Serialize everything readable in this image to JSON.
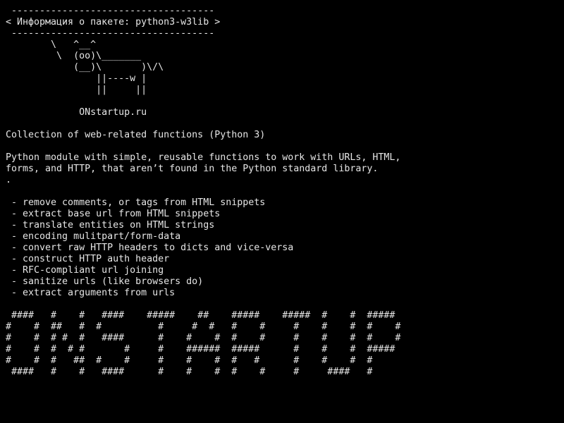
{
  "theme": {
    "background": "#000000",
    "foreground": "#e6e6e6"
  },
  "terminal": {
    "lines": [
      " ------------------------------------",
      "< Информация о пакете: python3-w3lib >",
      " ------------------------------------",
      "        \\   ^__^",
      "         \\  (oo)\\_______",
      "            (__)\\       )\\/\\",
      "                ||----w |",
      "                ||     ||",
      "",
      "             ONstartup.ru",
      "",
      "Collection of web-related functions (Python 3)",
      "",
      "Python module with simple, reusable functions to work with URLs, HTML,",
      "forms, and HTTP, that aren’t found in the Python standard library.",
      ".",
      "",
      " - remove comments, or tags from HTML snippets",
      " - extract base url from HTML snippets",
      " - translate entities on HTML strings",
      " - encoding mulitpart/form-data",
      " - convert raw HTTP headers to dicts and vice-versa",
      " - construct HTTP auth header",
      " - RFC-compliant url joining",
      " - sanitize urls (like browsers do)",
      " - extract arguments from urls",
      "",
      " ####   #    #   ####    #####    ##    #####    #####  #    #  #####",
      "#    #  ##   #  #          #     #  #   #    #     #    #    #  #    #",
      "#    #  # #  #   ####      #    #    #  #    #     #    #    #  #    #",
      "#    #  #  # #       #     #    ######  #####      #    #    #  #####",
      "#    #  #   ##  #    #     #    #    #  #   #      #    #    #  #",
      " ####   #    #   ####      #    #    #  #    #     #     ####   #"
    ]
  }
}
